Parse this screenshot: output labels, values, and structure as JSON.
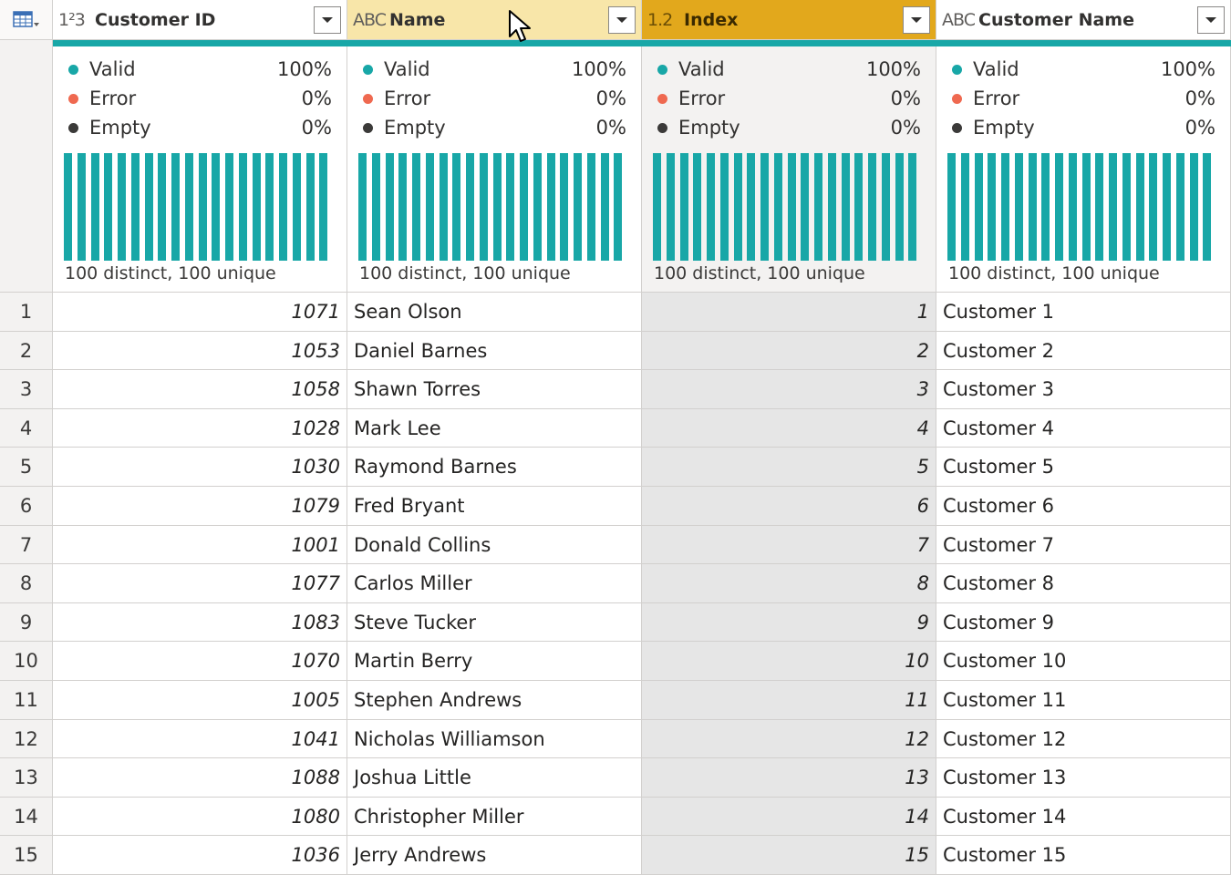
{
  "table_icon": "table-menu-icon",
  "columns": [
    {
      "key": "customer_id",
      "name": "Customer ID",
      "type_icon": "1²3",
      "type_name": "whole-number-type-icon",
      "state": "normal",
      "align": "num"
    },
    {
      "key": "name",
      "name": "Name",
      "type_icon": "ABC",
      "type_name": "text-type-icon",
      "state": "hover",
      "align": "txt"
    },
    {
      "key": "index",
      "name": "Index",
      "type_icon": "1.2",
      "type_name": "decimal-type-icon",
      "state": "selected",
      "align": "num"
    },
    {
      "key": "customer_name",
      "name": "Customer Name",
      "type_icon": "ABC",
      "type_name": "text-type-icon",
      "state": "normal",
      "align": "txt"
    }
  ],
  "profile": {
    "valid_label": "Valid",
    "error_label": "Error",
    "empty_label": "Empty",
    "valid_pct": "100%",
    "error_pct": "0%",
    "empty_pct": "0%",
    "distinct_text": "100 distinct, 100 unique",
    "bar_count": 20,
    "colors": {
      "valid": "#18a7a7",
      "error": "#ef6950",
      "empty": "#3b3a39"
    }
  },
  "rows": [
    {
      "n": "1",
      "customer_id": "1071",
      "name": "Sean Olson",
      "index": "1",
      "customer_name": "Customer 1"
    },
    {
      "n": "2",
      "customer_id": "1053",
      "name": "Daniel Barnes",
      "index": "2",
      "customer_name": "Customer 2"
    },
    {
      "n": "3",
      "customer_id": "1058",
      "name": "Shawn Torres",
      "index": "3",
      "customer_name": "Customer 3"
    },
    {
      "n": "4",
      "customer_id": "1028",
      "name": "Mark Lee",
      "index": "4",
      "customer_name": "Customer 4"
    },
    {
      "n": "5",
      "customer_id": "1030",
      "name": "Raymond Barnes",
      "index": "5",
      "customer_name": "Customer 5"
    },
    {
      "n": "6",
      "customer_id": "1079",
      "name": "Fred Bryant",
      "index": "6",
      "customer_name": "Customer 6"
    },
    {
      "n": "7",
      "customer_id": "1001",
      "name": "Donald Collins",
      "index": "7",
      "customer_name": "Customer 7"
    },
    {
      "n": "8",
      "customer_id": "1077",
      "name": "Carlos Miller",
      "index": "8",
      "customer_name": "Customer 8"
    },
    {
      "n": "9",
      "customer_id": "1083",
      "name": "Steve Tucker",
      "index": "9",
      "customer_name": "Customer 9"
    },
    {
      "n": "10",
      "customer_id": "1070",
      "name": "Martin Berry",
      "index": "10",
      "customer_name": "Customer 10"
    },
    {
      "n": "11",
      "customer_id": "1005",
      "name": "Stephen Andrews",
      "index": "11",
      "customer_name": "Customer 11"
    },
    {
      "n": "12",
      "customer_id": "1041",
      "name": "Nicholas Williamson",
      "index": "12",
      "customer_name": "Customer 12"
    },
    {
      "n": "13",
      "customer_id": "1088",
      "name": "Joshua Little",
      "index": "13",
      "customer_name": "Customer 13"
    },
    {
      "n": "14",
      "customer_id": "1080",
      "name": "Christopher Miller",
      "index": "14",
      "customer_name": "Customer 14"
    },
    {
      "n": "15",
      "customer_id": "1036",
      "name": "Jerry Andrews",
      "index": "15",
      "customer_name": "Customer 15"
    }
  ]
}
